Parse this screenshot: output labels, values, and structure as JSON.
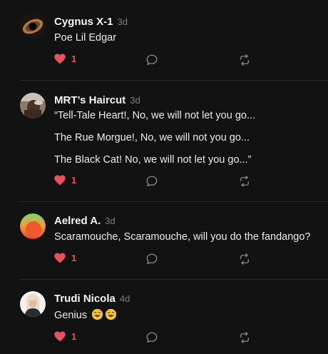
{
  "posts": [
    {
      "author": "Cygnus X-1",
      "time": "3d",
      "lines": [
        "Poe Lil Edgar"
      ],
      "likes": "1",
      "avatar": "black-hole-avatar"
    },
    {
      "author": "MRT’s Haircut",
      "time": "3d",
      "lines": [
        "“Tell-Tale Heart!, No, we will not let you go...",
        "The Rue Morgue!, No, we will not you go...",
        "The Black Cat! No, we will not let you go...”"
      ],
      "likes": "1",
      "avatar": "photo-avatar"
    },
    {
      "author": "Aelred A.",
      "time": "3d",
      "lines": [
        "Scaramouche, Scaramouche, will you do the fandango?"
      ],
      "likes": "1",
      "avatar": "gradient-avatar"
    },
    {
      "author": "Trudi Nicola",
      "time": "4d",
      "lines": [
        "Genius"
      ],
      "likes": "1",
      "avatar": "photo-avatar",
      "emojis": [
        "laughing-emoji",
        "laughing-emoji"
      ]
    }
  ],
  "colors": {
    "background": "#121212",
    "like": "#e8525d",
    "muted": "#7c7c7c",
    "divider": "#2a2a2a"
  },
  "icons": [
    "heart-icon",
    "reply-bubble-icon",
    "repost-icon"
  ]
}
